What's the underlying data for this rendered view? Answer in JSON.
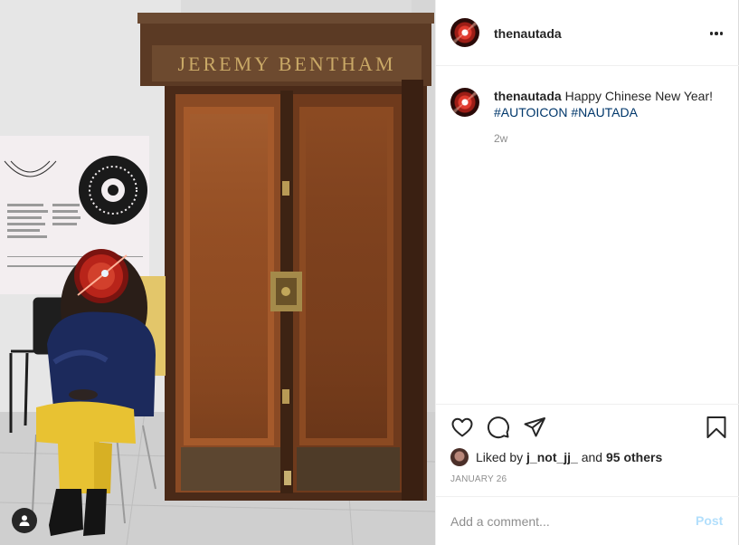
{
  "author": {
    "username": "thenautada"
  },
  "header": {
    "more_icon": "more-horizontal-icon"
  },
  "caption": {
    "username": "thenautada",
    "text": "Happy Chinese New Year!",
    "hashtags": [
      "#AUTOICON",
      "#NAUTADA"
    ],
    "time_ago": "2w"
  },
  "photo": {
    "sign_text": "JEREMY BENTHAM",
    "tag_icon": "user-icon"
  },
  "actions": {
    "like_icon": "heart-icon",
    "comment_icon": "comment-bubble-icon",
    "share_icon": "paper-plane-icon",
    "save_icon": "bookmark-icon"
  },
  "likes": {
    "prefix": "Liked by",
    "liker": "j_not_jj_",
    "joiner": "and",
    "others": "95 others"
  },
  "date": "JANUARY 26",
  "add_comment": {
    "placeholder": "Add a comment...",
    "post_label": "Post"
  },
  "colors": {
    "link": "#00376b",
    "post_disabled": "#b2dffc",
    "muted": "#8e8e8e"
  }
}
